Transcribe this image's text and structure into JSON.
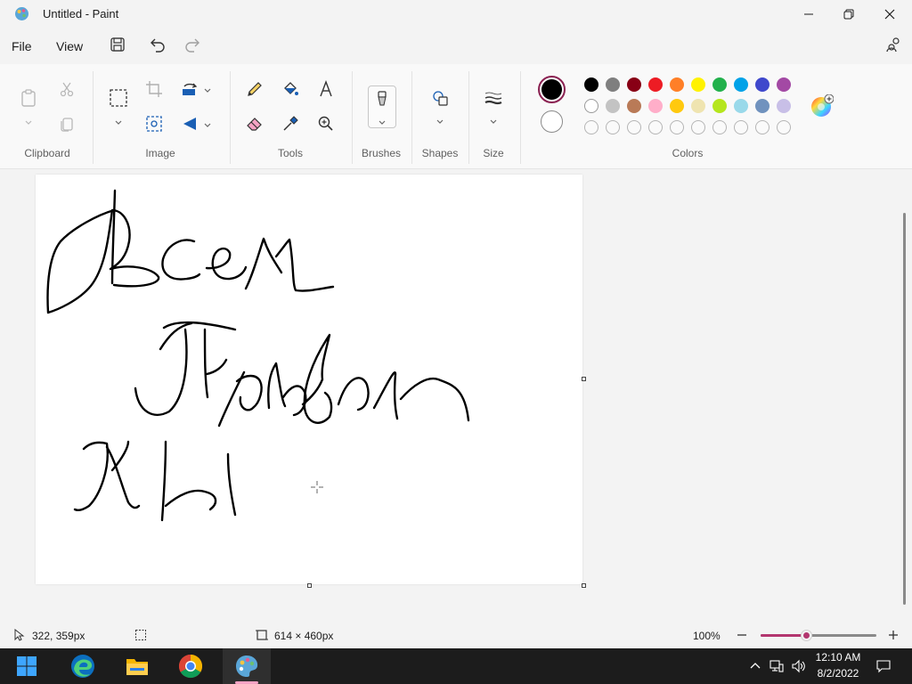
{
  "window": {
    "title": "Untitled - Paint"
  },
  "menu": {
    "file": "File",
    "view": "View"
  },
  "ribbon": {
    "groups": {
      "clipboard": "Clipboard",
      "image": "Image",
      "tools": "Tools",
      "brushes": "Brushes",
      "shapes": "Shapes",
      "size": "Size",
      "colors": "Colors"
    },
    "colors": {
      "primary": "#000000",
      "secondary": "#ffffff",
      "palette_row1": [
        "#000000",
        "#7f7f7f",
        "#880015",
        "#ed1c24",
        "#ff7f27",
        "#fff200",
        "#22b14c",
        "#00a2e8",
        "#3f48cc",
        "#a349a4"
      ],
      "palette_row2": [
        "#ffffff",
        "#c3c3c3",
        "#b97a57",
        "#ffaec9",
        "#ffc90e",
        "#efe4b0",
        "#b5e61d",
        "#99d9ea",
        "#7092be",
        "#c8bfe7"
      ],
      "palette_row3_empty_count": 10
    }
  },
  "status": {
    "cursor_position": "322, 359px",
    "canvas_size": "614 × 460px",
    "zoom": "100%",
    "zoom_level": 0.4
  },
  "taskbar": {
    "time": "12:10 AM",
    "date": "8/2/2022",
    "apps": [
      "start-icon",
      "edge-icon",
      "file-explorer-icon",
      "chrome-icon",
      "paint-icon"
    ]
  }
}
